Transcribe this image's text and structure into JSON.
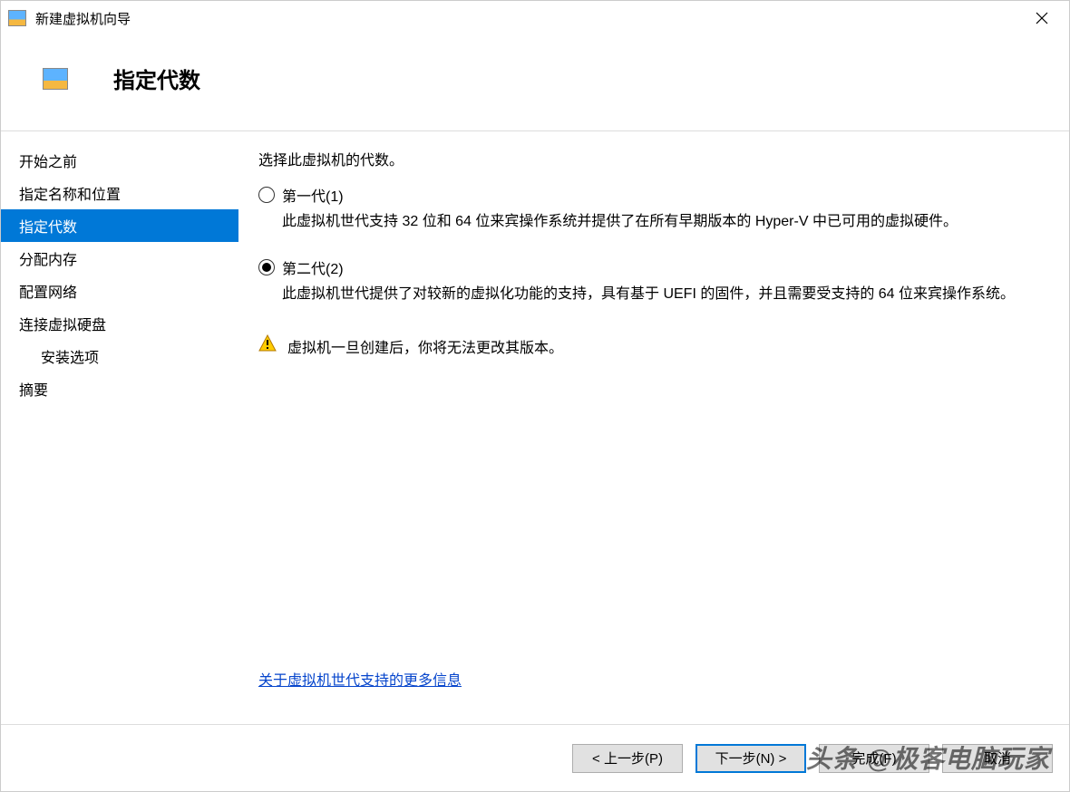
{
  "window": {
    "title": "新建虚拟机向导"
  },
  "header": {
    "title": "指定代数"
  },
  "sidebar": {
    "items": [
      {
        "label": "开始之前",
        "active": false
      },
      {
        "label": "指定名称和位置",
        "active": false
      },
      {
        "label": "指定代数",
        "active": true
      },
      {
        "label": "分配内存",
        "active": false
      },
      {
        "label": "配置网络",
        "active": false
      },
      {
        "label": "连接虚拟硬盘",
        "active": false
      },
      {
        "label": "安装选项",
        "active": false,
        "indent": true
      },
      {
        "label": "摘要",
        "active": false
      }
    ]
  },
  "main": {
    "prompt": "选择此虚拟机的代数。",
    "options": [
      {
        "label": "第一代(1)",
        "checked": false,
        "description": "此虚拟机世代支持 32 位和 64 位来宾操作系统并提供了在所有早期版本的 Hyper-V 中已可用的虚拟硬件。"
      },
      {
        "label": "第二代(2)",
        "checked": true,
        "description": "此虚拟机世代提供了对较新的虚拟化功能的支持，具有基于 UEFI 的固件，并且需要受支持的 64 位来宾操作系统。"
      }
    ],
    "warning": "虚拟机一旦创建后，你将无法更改其版本。",
    "more_info_link": "关于虚拟机世代支持的更多信息"
  },
  "footer": {
    "back": "< 上一步(P)",
    "next": "下一步(N) >",
    "finish": "完成(F)",
    "cancel": "取消"
  },
  "watermark": "头条 @极客电脑玩家"
}
